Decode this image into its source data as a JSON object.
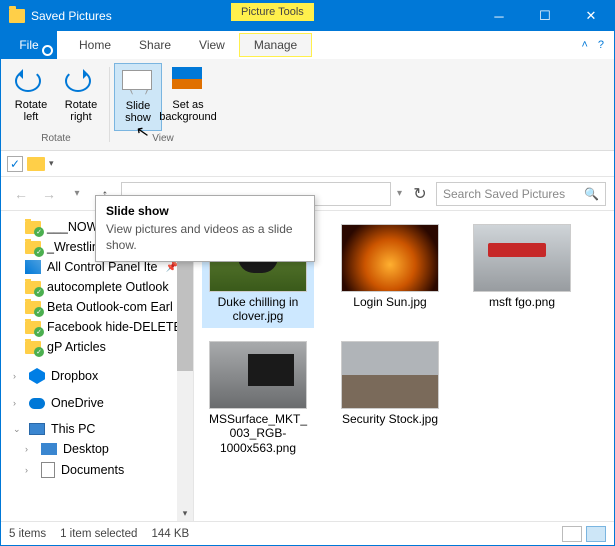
{
  "titlebar": {
    "title": "Saved Pictures",
    "context_tab": "Picture Tools"
  },
  "menubar": {
    "file": "File",
    "tabs": [
      "Home",
      "Share",
      "View"
    ],
    "manage": "Manage"
  },
  "ribbon": {
    "rotate_left": "Rotate left",
    "rotate_right": "Rotate right",
    "slide_show": "Slide show",
    "set_bg": "Set as background",
    "group_rotate": "Rotate",
    "group_view": "View"
  },
  "tooltip": {
    "title": "Slide show",
    "body": "View pictures and videos as a slide show."
  },
  "search": {
    "placeholder": "Search Saved Pictures"
  },
  "tree": {
    "items": [
      {
        "label": "___NOW",
        "icon": "folder-green",
        "pin": true
      },
      {
        "label": "_Wrestling and MM",
        "icon": "folder-green",
        "pin": true
      },
      {
        "label": "All Control Panel Ite",
        "icon": "cp",
        "pin": true
      },
      {
        "label": "autocomplete Outlook",
        "icon": "folder-green",
        "pin": true
      },
      {
        "label": "Beta Outlook-com Earl",
        "icon": "folder-green",
        "pin": true
      },
      {
        "label": "Facebook hide-DELETE",
        "icon": "folder-green",
        "pin": true
      },
      {
        "label": "gP Articles",
        "icon": "folder-green",
        "pin": true
      }
    ],
    "dropbox": "Dropbox",
    "onedrive": "OneDrive",
    "thispc": "This PC",
    "desktop": "Desktop",
    "documents": "Documents"
  },
  "files": [
    {
      "name": "Duke chilling in clover.jpg",
      "thumb": "t1",
      "selected": true
    },
    {
      "name": "Login Sun.jpg",
      "thumb": "t2"
    },
    {
      "name": "msft fgo.png",
      "thumb": "t5"
    },
    {
      "name": "MSSurface_MKT_003_RGB-1000x563.png",
      "thumb": "t3"
    },
    {
      "name": "Security Stock.jpg",
      "thumb": "t4"
    }
  ],
  "status": {
    "count": "5 items",
    "selection": "1 item selected",
    "size": "144 KB"
  }
}
